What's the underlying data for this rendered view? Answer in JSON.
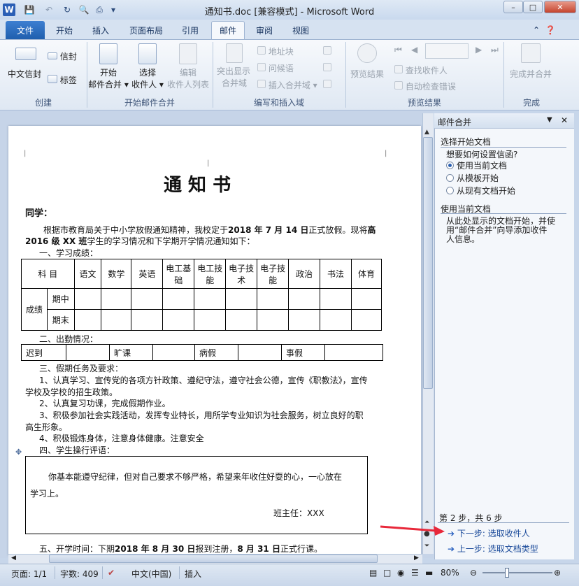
{
  "titlebar": {
    "title": "通知书.doc [兼容模式] - Microsoft Word",
    "app_icon": "W",
    "minimize": "–",
    "maximize": "□",
    "close": "✕"
  },
  "tabs": [
    "文件",
    "开始",
    "插入",
    "页面布局",
    "引用",
    "邮件",
    "审阅",
    "视图"
  ],
  "ribbon": {
    "create": {
      "label": "创建",
      "chinese_envelope": "中文信封",
      "envelope": "信封",
      "labels": "标签"
    },
    "start_merge": {
      "label": "开始邮件合并",
      "start_line1": "开始",
      "start_line2": "邮件合并",
      "select_line1": "选择",
      "select_line2": "收件人",
      "edit_line1": "编辑",
      "edit_line2": "收件人列表"
    },
    "write_insert": {
      "label": "编写和插入域",
      "highlight_line1": "突出显示",
      "highlight_line2": "合并域",
      "address_block": "地址块",
      "greeting_line": "问候语",
      "insert_field": "插入合并域"
    },
    "preview": {
      "label": "预览结果",
      "preview_results": "预览结果",
      "find_recipient": "查找收件人",
      "auto_check": "自动检查错误"
    },
    "finish": {
      "label": "完成",
      "finish_merge": "完成并合并"
    }
  },
  "document": {
    "title": "通 知 书",
    "greeting": "同学：",
    "para1_a": "根据市教育局关于中小学放假通知精神，我校定于",
    "para1_b": "2018 年 7 月 14 日",
    "para1_c": "正式放假。现将",
    "para1_d": "高",
    "para2_a": "2016 级 XX 班",
    "para2_b": "学生的学习情况和下学期开学情况通知如下：",
    "sec1": "一、学习成绩：",
    "grades": {
      "subject_header": "科 目",
      "subjects": [
        "语文",
        "数学",
        "英语",
        "电工基础",
        "电工技能",
        "电子技术",
        "电子技能",
        "政治",
        "书法",
        "体育"
      ],
      "row_group": "成绩",
      "rows": [
        "期中",
        "期末"
      ]
    },
    "sec2": "二、出勤情况：",
    "attendance": [
      "迟到",
      "旷课",
      "病假",
      "事假"
    ],
    "sec3": "三、假期任务及要求：",
    "item1_a": "1、认真学习、宣传党的各项方针政策、遵纪守法，遵守社会公德，宣传《职教法》，宣传",
    "item1_b": "学校及学校的招生政策。",
    "item2": "2、认真复习功课，完成假期作业。",
    "item3_a": "3、积极参加社会实践活动，发挥专业特长，用所学专业知识为社会服务，树立良好的职",
    "item3_b": "高生形象。",
    "item4": "4、积极锻炼身体，注意身体健康。注意安全",
    "sec4": "四、学生操行评语：",
    "comment_a": "你基本能遵守纪律，但对自己要求不够严格，希望来年收住好耍的心，一心放在",
    "comment_b": "学习上。",
    "signature": "班主任：XXX",
    "sec5_a": "五、开学时间：下期",
    "sec5_b": "2018 年 8 月 30 日",
    "sec5_c": "报到注册，",
    "sec5_d": "8 月 31 日",
    "sec5_e": "正式行课。"
  },
  "pane": {
    "title": "邮件合并",
    "heading": "选择开始文档",
    "question": "想要如何设置信函?",
    "options": [
      "使用当前文档",
      "从模板开始",
      "从现有文档开始"
    ],
    "selected_index": 0,
    "sub_heading": "使用当前文档",
    "desc_1": "从此处显示的文档开始，并使",
    "desc_2": "用“邮件合并”向导添加收件",
    "desc_3": "人信息。",
    "step": "第 2 步，共 6 步",
    "next": "下一步: 选取收件人",
    "prev": "上一步: 选取文档类型"
  },
  "statusbar": {
    "page": "页面: 1/1",
    "words": "字数: 409",
    "language": "中文(中国)",
    "mode": "插入",
    "zoom": "80%"
  },
  "colors": {
    "accent": "#1f5fae",
    "arrow": "#e8283a"
  }
}
